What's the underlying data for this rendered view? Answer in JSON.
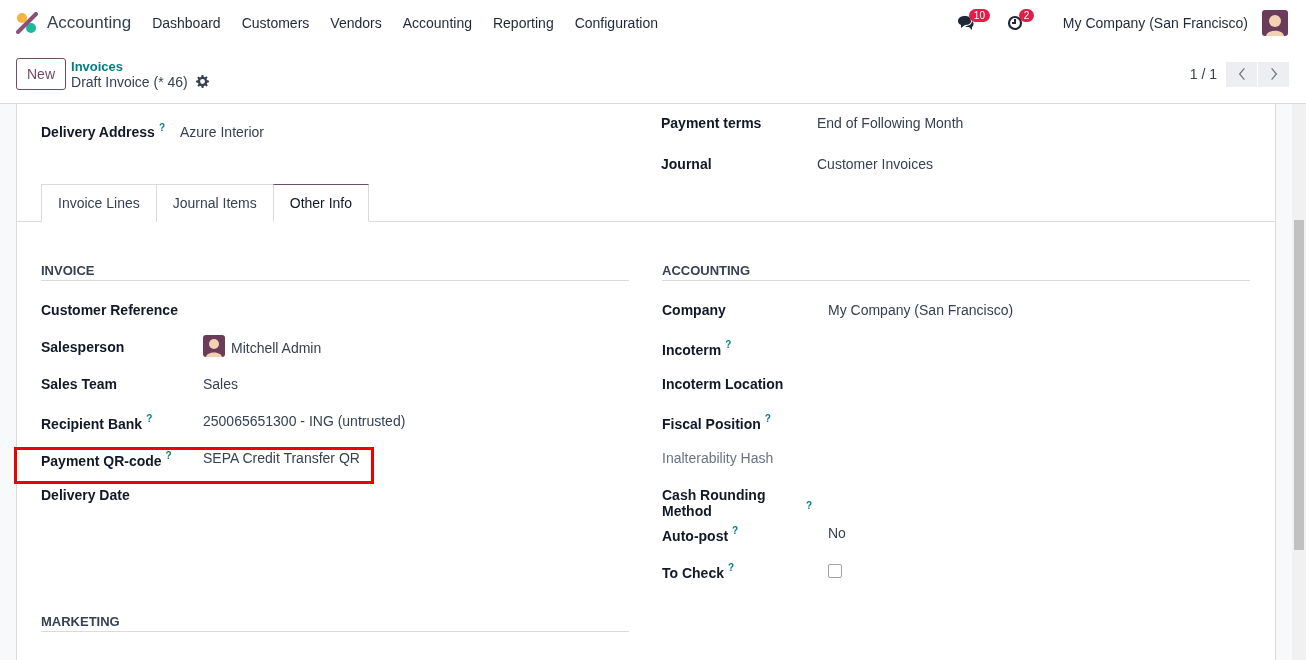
{
  "navbar": {
    "app_name": "Accounting",
    "menu": [
      "Dashboard",
      "Customers",
      "Vendors",
      "Accounting",
      "Reporting",
      "Configuration"
    ],
    "messages_count": "10",
    "activities_count": "2",
    "company": "My Company (San Francisco)"
  },
  "control_panel": {
    "new_button": "New",
    "breadcrumb": "Invoices",
    "record_title": "Draft Invoice (* 46)",
    "pager": "1 / 1"
  },
  "header_fields": {
    "left": [
      {
        "label": "Delivery Address",
        "help": "?",
        "value": "Azure Interior"
      }
    ],
    "right": [
      {
        "label": "Payment terms",
        "value": "End of Following Month"
      },
      {
        "label": "Journal",
        "value": "Customer Invoices"
      }
    ]
  },
  "tabs": [
    {
      "label": "Invoice Lines",
      "selected": false
    },
    {
      "label": "Journal Items",
      "selected": false
    },
    {
      "label": "Other Info",
      "selected": true
    }
  ],
  "sections": [
    {
      "title": "INVOICE",
      "fields": [
        {
          "kind": "text",
          "label": "Customer Reference",
          "muted": false,
          "highlighted": false
        },
        {
          "kind": "avatar",
          "label": "Salesperson",
          "muted": false,
          "highlighted": false,
          "value": "Mitchell Admin"
        },
        {
          "kind": "text",
          "label": "Sales Team",
          "muted": false,
          "highlighted": false,
          "value": "Sales"
        },
        {
          "kind": "text",
          "label": "Recipient Bank",
          "help": "?",
          "muted": false,
          "highlighted": false,
          "value": "250065651300 - ING (untrusted)"
        },
        {
          "kind": "text",
          "label": "Payment QR-code",
          "help": "?",
          "muted": false,
          "highlighted": true,
          "value": "SEPA Credit Transfer QR"
        },
        {
          "kind": "text",
          "label": "Delivery Date",
          "muted": false,
          "highlighted": false
        }
      ]
    },
    {
      "title": "ACCOUNTING",
      "fields": [
        {
          "kind": "text",
          "label": "Company",
          "muted": false,
          "highlighted": false,
          "value": "My Company (San Francisco)"
        },
        {
          "kind": "text",
          "label": "Incoterm",
          "help": "?",
          "muted": false,
          "highlighted": false
        },
        {
          "kind": "text",
          "label": "Incoterm Location",
          "muted": false,
          "highlighted": false
        },
        {
          "kind": "text",
          "label": "Fiscal Position",
          "help": "?",
          "muted": false,
          "highlighted": false
        },
        {
          "kind": "text",
          "label": "Inalterability Hash",
          "muted": true,
          "highlighted": false
        },
        {
          "kind": "text",
          "label": "Cash Rounding Method",
          "help": "?",
          "muted": false,
          "highlighted": false
        },
        {
          "kind": "text",
          "label": "Auto-post",
          "help": "?",
          "muted": false,
          "highlighted": false,
          "value": "No"
        },
        {
          "kind": "checkbox",
          "label": "To Check",
          "help": "?",
          "muted": false,
          "highlighted": false,
          "checked": false
        }
      ]
    }
  ],
  "bottom_section": {
    "title": "MARKETING"
  }
}
